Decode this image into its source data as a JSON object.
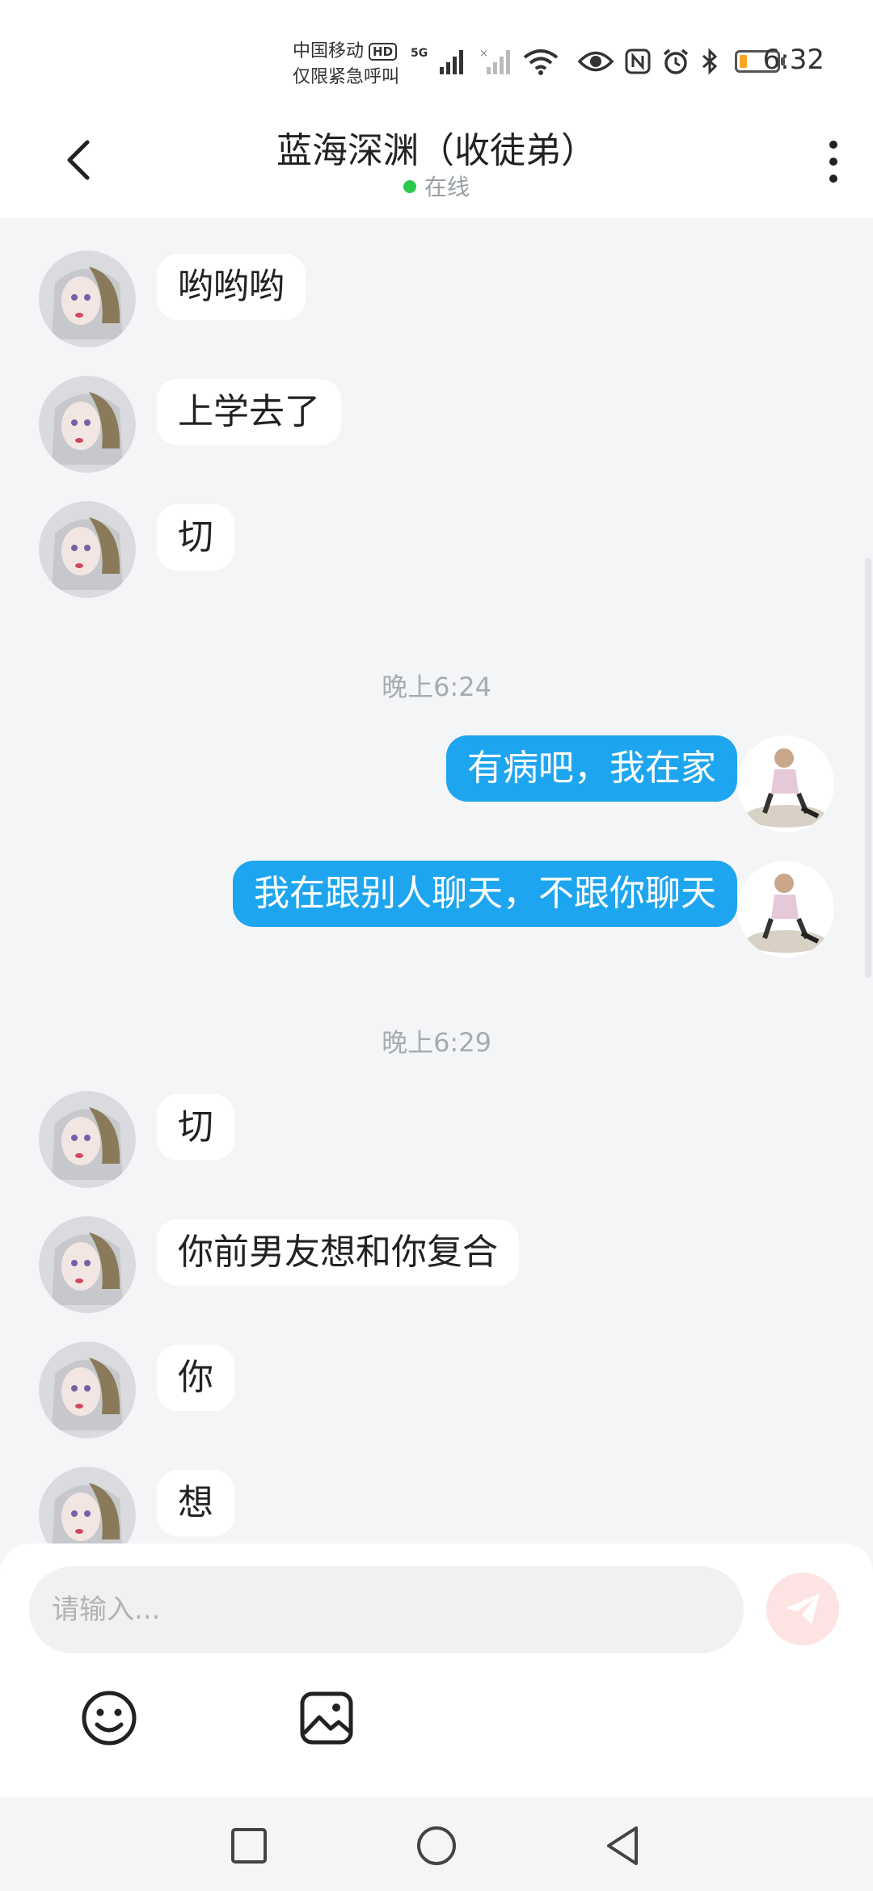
{
  "status_bar": {
    "carrier_line1": "中国移动",
    "hd_badge": "HD",
    "carrier_line2": "仅限紧急呼叫",
    "network": "5G",
    "time": "6:32",
    "battery_level_percent": 20,
    "icons": [
      "signal-icon",
      "signal-no-service-icon",
      "wifi-icon",
      "eye-icon",
      "nfc-icon",
      "alarm-icon",
      "bluetooth-icon",
      "battery-icon"
    ]
  },
  "header": {
    "title": "蓝海深渊（收徒弟）",
    "status": "在线",
    "status_color": "#2cc84d"
  },
  "messages": [
    {
      "dir": "in",
      "text": "哟哟哟"
    },
    {
      "dir": "in",
      "text": "上学去了"
    },
    {
      "dir": "in",
      "text": "切"
    },
    {
      "time": "晚上6:24"
    },
    {
      "dir": "out",
      "text": "有病吧，我在家"
    },
    {
      "dir": "out",
      "text": "我在跟别人聊天，不跟你聊天"
    },
    {
      "time": "晚上6:29"
    },
    {
      "dir": "in",
      "text": "切"
    },
    {
      "dir": "in",
      "text": "你前男友想和你复合"
    },
    {
      "dir": "in",
      "text": "你"
    },
    {
      "dir": "in",
      "text": "想"
    }
  ],
  "composer": {
    "placeholder": "请输入...",
    "value": "",
    "send_icon": "send-icon",
    "tools": [
      "emoji-icon",
      "image-icon"
    ]
  },
  "navbar": {
    "buttons": [
      "recents-icon",
      "home-icon",
      "back-icon"
    ]
  },
  "colors": {
    "outgoing_bubble": "#1ea5f0",
    "incoming_bubble": "#ffffff",
    "background": "#f4f5f7"
  }
}
